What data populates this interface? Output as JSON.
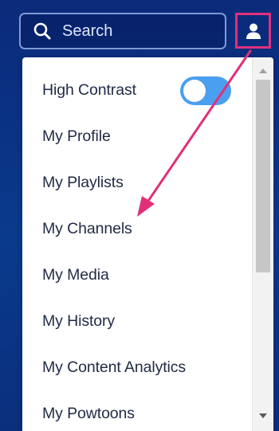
{
  "search": {
    "placeholder": "Search"
  },
  "user_button": {
    "icon": "user-icon"
  },
  "menu": {
    "items": [
      {
        "label": "High Contrast",
        "has_toggle": true
      },
      {
        "label": "My Profile"
      },
      {
        "label": "My Playlists"
      },
      {
        "label": "My Channels"
      },
      {
        "label": "My Media"
      },
      {
        "label": "My History"
      },
      {
        "label": "My Content Analytics"
      },
      {
        "label": "My Powtoons"
      }
    ],
    "high_contrast_enabled": true
  },
  "colors": {
    "background": "#0b2a7a",
    "highlight": "#e0307a",
    "toggle_on": "#4a9ff0",
    "menu_text": "#1f2a44"
  }
}
